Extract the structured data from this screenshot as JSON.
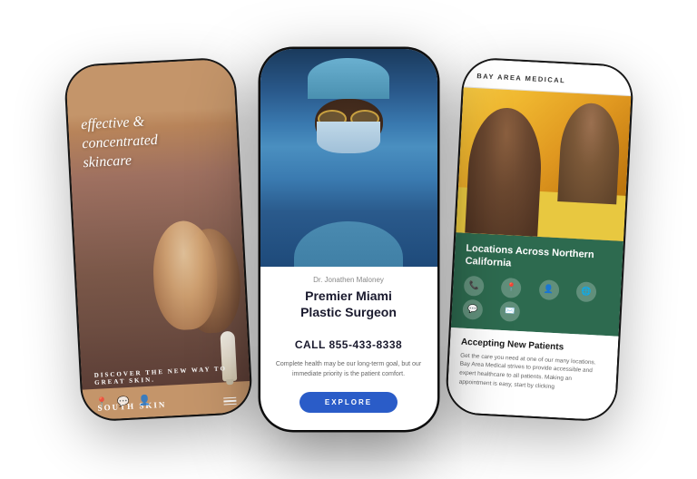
{
  "phone1": {
    "logo": "SOUTH SKIN",
    "tagline_line1": "effective &",
    "tagline_line2": "concentrated",
    "tagline_line3": "skincare",
    "cta": "DISCOVER THE NEW WAY TO GREAT SKIN."
  },
  "phone2": {
    "doctor_name": "Dr. Jonathen Maloney",
    "title_line1": "Premier Miami",
    "title_line2": "Plastic Surgeon",
    "phone": "CALL 855-433-8338",
    "description": "Complete health may be our long-term goal, but our immediate priority is the patient comfort.",
    "button_label": "EXPLORE"
  },
  "phone3": {
    "logo": "BAY AREA MEDICAL",
    "green_title": "Locations Across Northern California",
    "accepting_title": "Accepting New Patients",
    "description": "Get the care you need at one of our many locations. Bay Area Medical strives to provide accessible and expert healthcare to all patients. Making an appointment is easy, start by clicking"
  }
}
